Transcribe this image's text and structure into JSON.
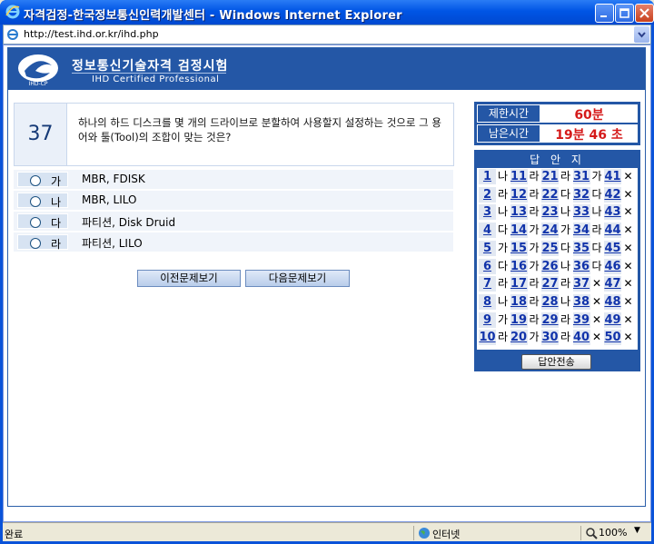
{
  "window": {
    "title": "자격검정-한국정보통신인력개발센터 - Windows Internet Explorer"
  },
  "address": {
    "url": "http://test.ihd.or.kr/ihd.php"
  },
  "banner": {
    "title_kor": "정보통신기술자격 검정시험",
    "title_eng": "IHD Certified Professional",
    "logo_text": "IHD-CP"
  },
  "question": {
    "number": "37",
    "text": "하나의 하드 디스크를 몇 개의 드라이브로 분할하여 사용할지 설정하는 것으로 그 용어와 툴(Tool)의 조합이 맞는 것은?"
  },
  "options": [
    {
      "letter": "가",
      "text": "MBR, FDISK"
    },
    {
      "letter": "나",
      "text": "MBR, LILO"
    },
    {
      "letter": "다",
      "text": "파티션, Disk Druid"
    },
    {
      "letter": "라",
      "text": "파티션, LILO"
    }
  ],
  "nav": {
    "prev_label": "이전문제보기",
    "next_label": "다음문제보기"
  },
  "timer": {
    "limit_label": "제한시간",
    "limit_value": "60분",
    "remain_label": "남은시간",
    "remain_value": "19분 46 초"
  },
  "answer_sheet": {
    "title": "답 안 지",
    "submit_label": "답안전송",
    "items": [
      {
        "n": "1",
        "a": "나"
      },
      {
        "n": "2",
        "a": "라"
      },
      {
        "n": "3",
        "a": "나"
      },
      {
        "n": "4",
        "a": "다"
      },
      {
        "n": "5",
        "a": "가"
      },
      {
        "n": "6",
        "a": "다"
      },
      {
        "n": "7",
        "a": "라"
      },
      {
        "n": "8",
        "a": "나"
      },
      {
        "n": "9",
        "a": "가"
      },
      {
        "n": "10",
        "a": "라"
      },
      {
        "n": "11",
        "a": "라"
      },
      {
        "n": "12",
        "a": "라"
      },
      {
        "n": "13",
        "a": "라"
      },
      {
        "n": "14",
        "a": "가"
      },
      {
        "n": "15",
        "a": "가"
      },
      {
        "n": "16",
        "a": "가"
      },
      {
        "n": "17",
        "a": "라"
      },
      {
        "n": "18",
        "a": "라"
      },
      {
        "n": "19",
        "a": "라"
      },
      {
        "n": "20",
        "a": "가"
      },
      {
        "n": "21",
        "a": "라"
      },
      {
        "n": "22",
        "a": "다"
      },
      {
        "n": "23",
        "a": "나"
      },
      {
        "n": "24",
        "a": "가"
      },
      {
        "n": "25",
        "a": "다"
      },
      {
        "n": "26",
        "a": "나"
      },
      {
        "n": "27",
        "a": "라"
      },
      {
        "n": "28",
        "a": "나"
      },
      {
        "n": "29",
        "a": "라"
      },
      {
        "n": "30",
        "a": "라"
      },
      {
        "n": "31",
        "a": "가"
      },
      {
        "n": "32",
        "a": "다"
      },
      {
        "n": "33",
        "a": "나"
      },
      {
        "n": "34",
        "a": "라"
      },
      {
        "n": "35",
        "a": "다"
      },
      {
        "n": "36",
        "a": "다"
      },
      {
        "n": "37",
        "a": "✕"
      },
      {
        "n": "38",
        "a": "✕"
      },
      {
        "n": "39",
        "a": "✕"
      },
      {
        "n": "40",
        "a": "✕"
      },
      {
        "n": "41",
        "a": "✕"
      },
      {
        "n": "42",
        "a": "✕"
      },
      {
        "n": "43",
        "a": "✕"
      },
      {
        "n": "44",
        "a": "✕"
      },
      {
        "n": "45",
        "a": "✕"
      },
      {
        "n": "46",
        "a": "✕"
      },
      {
        "n": "47",
        "a": "✕"
      },
      {
        "n": "48",
        "a": "✕"
      },
      {
        "n": "49",
        "a": "✕"
      },
      {
        "n": "50",
        "a": "✕"
      }
    ]
  },
  "status": {
    "text": "완료",
    "zone": "인터넷",
    "zoom": "100%"
  },
  "colors": {
    "navy": "#2457a6",
    "timer_red": "#d51a1a",
    "link_blue": "#1133aa"
  },
  "icons": [
    "ie-icon",
    "minimize-icon",
    "maximize-icon",
    "close-icon",
    "page-icon",
    "globe-icon",
    "zoom-icon"
  ]
}
